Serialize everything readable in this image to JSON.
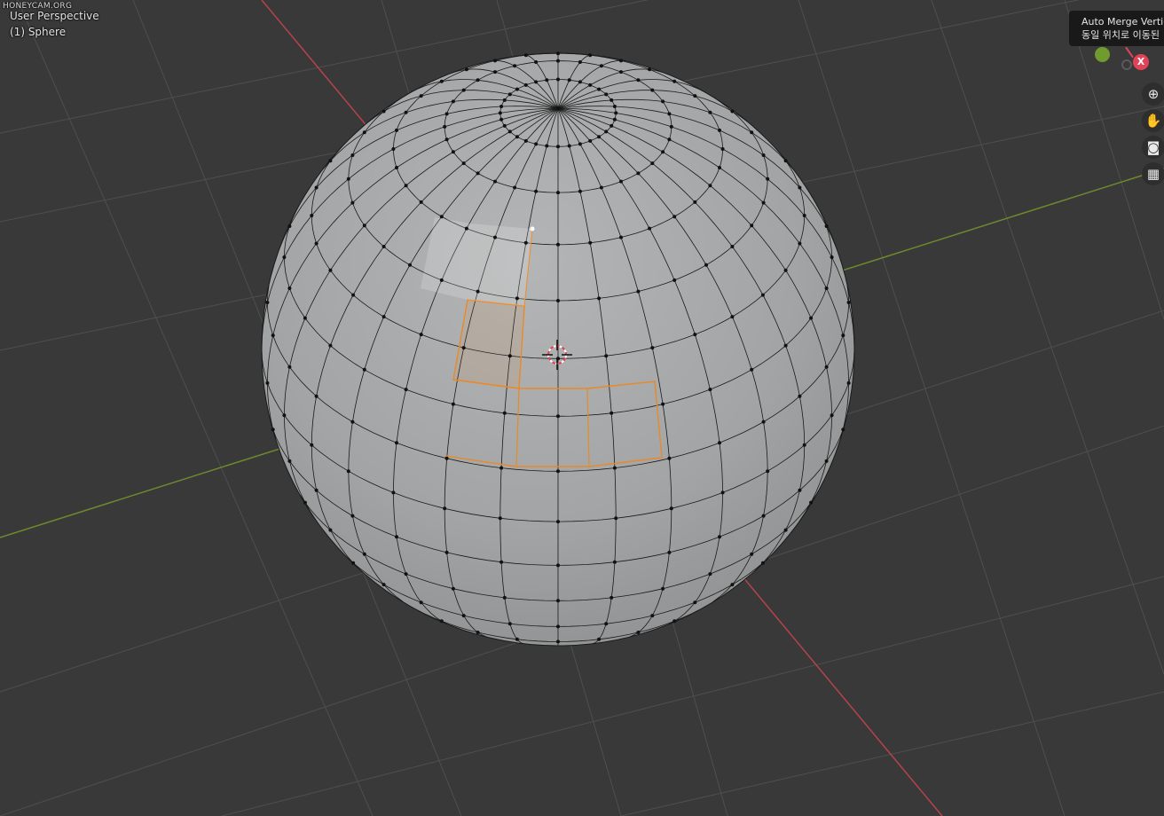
{
  "watermark": "HONEYCAM.ORG",
  "viewport": {
    "view_name": "User Perspective",
    "object_name": "(1) Sphere"
  },
  "tooltip": {
    "title": "Auto Merge Vertices",
    "description": "동일 위치로 이동된"
  },
  "gizmo": {
    "x_label": "X",
    "colors": {
      "x_axis": "#e04358",
      "y_axis": "#6f9b2f"
    }
  },
  "nav_icons": [
    "zoom-icon",
    "pan-hand-icon",
    "camera-icon",
    "grid-icon"
  ],
  "colors": {
    "background": "#393939",
    "grid": "#4f4f4f",
    "x_axis_line": "#b5434c",
    "y_axis_line": "#6c8b2c",
    "mesh_face": "#a0a2a3",
    "mesh_edge": "#1a1a1a",
    "selection": "#e8892a"
  }
}
